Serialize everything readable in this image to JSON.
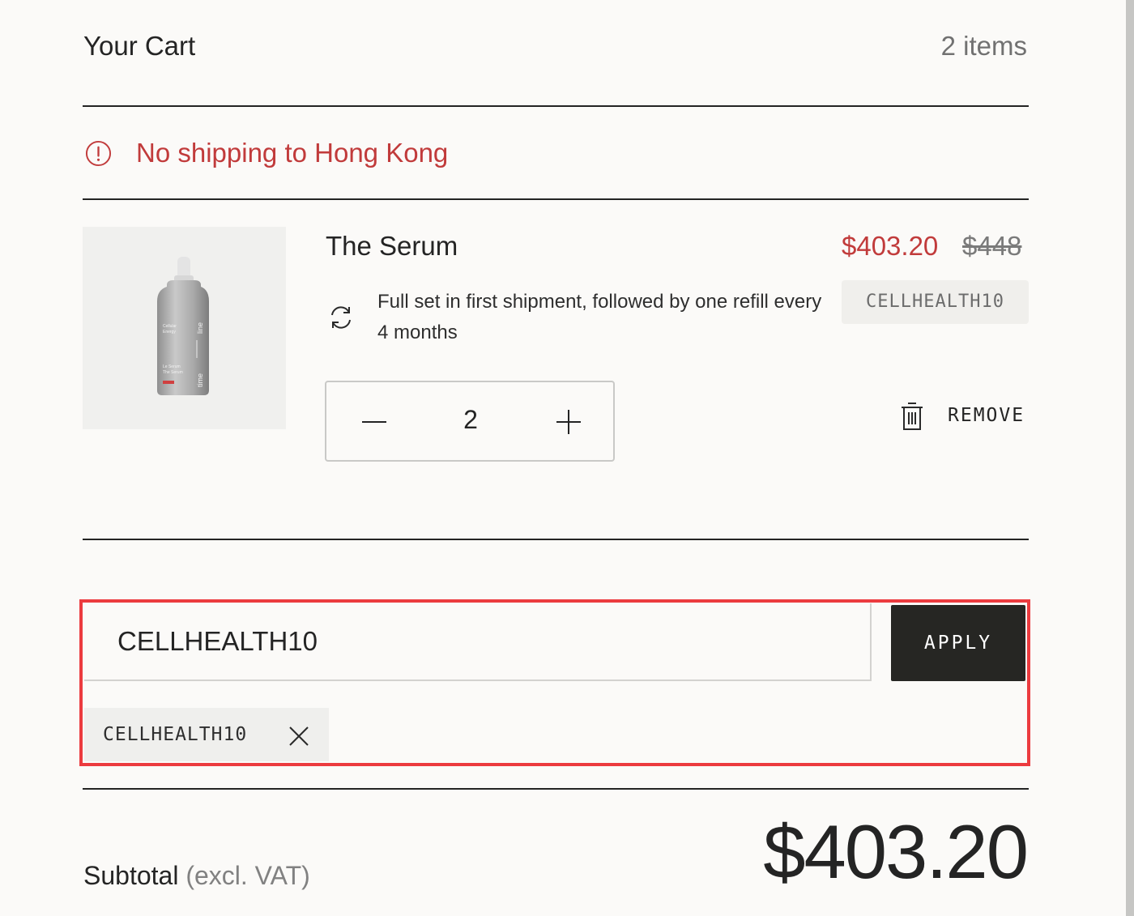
{
  "header": {
    "title": "Your Cart",
    "item_count": "2 items"
  },
  "alert": {
    "icon": "alert-circle-icon",
    "text": "No shipping to Hong Kong",
    "color": "#c13b3b"
  },
  "item": {
    "title": "The Serum",
    "sale_price": "$403.20",
    "original_price": "$448",
    "discount_code": "CELLHEALTH10",
    "subscription_icon": "refresh-icon",
    "subscription_text": "Full set in first shipment, followed by one refill every 4 months",
    "quantity": "2",
    "decrease_icon": "minus-icon",
    "increase_icon": "plus-icon",
    "remove_icon": "trash-icon",
    "remove_label": "REMOVE",
    "bottle_label": {
      "line1": "Cellular",
      "line2": "Energy",
      "line3": "Le Serum",
      "line4": "The Serum",
      "brand_left": "time",
      "brand_right": "line"
    }
  },
  "promo": {
    "input_value": "CELLHEALTH10",
    "apply_label": "APPLY",
    "applied_code": "CELLHEALTH10",
    "remove_icon": "close-icon",
    "highlight_color": "#ec3b3f"
  },
  "summary": {
    "subtotal_label": "Subtotal",
    "subtotal_note": "(excl. VAT)",
    "subtotal_value": "$403.20"
  }
}
